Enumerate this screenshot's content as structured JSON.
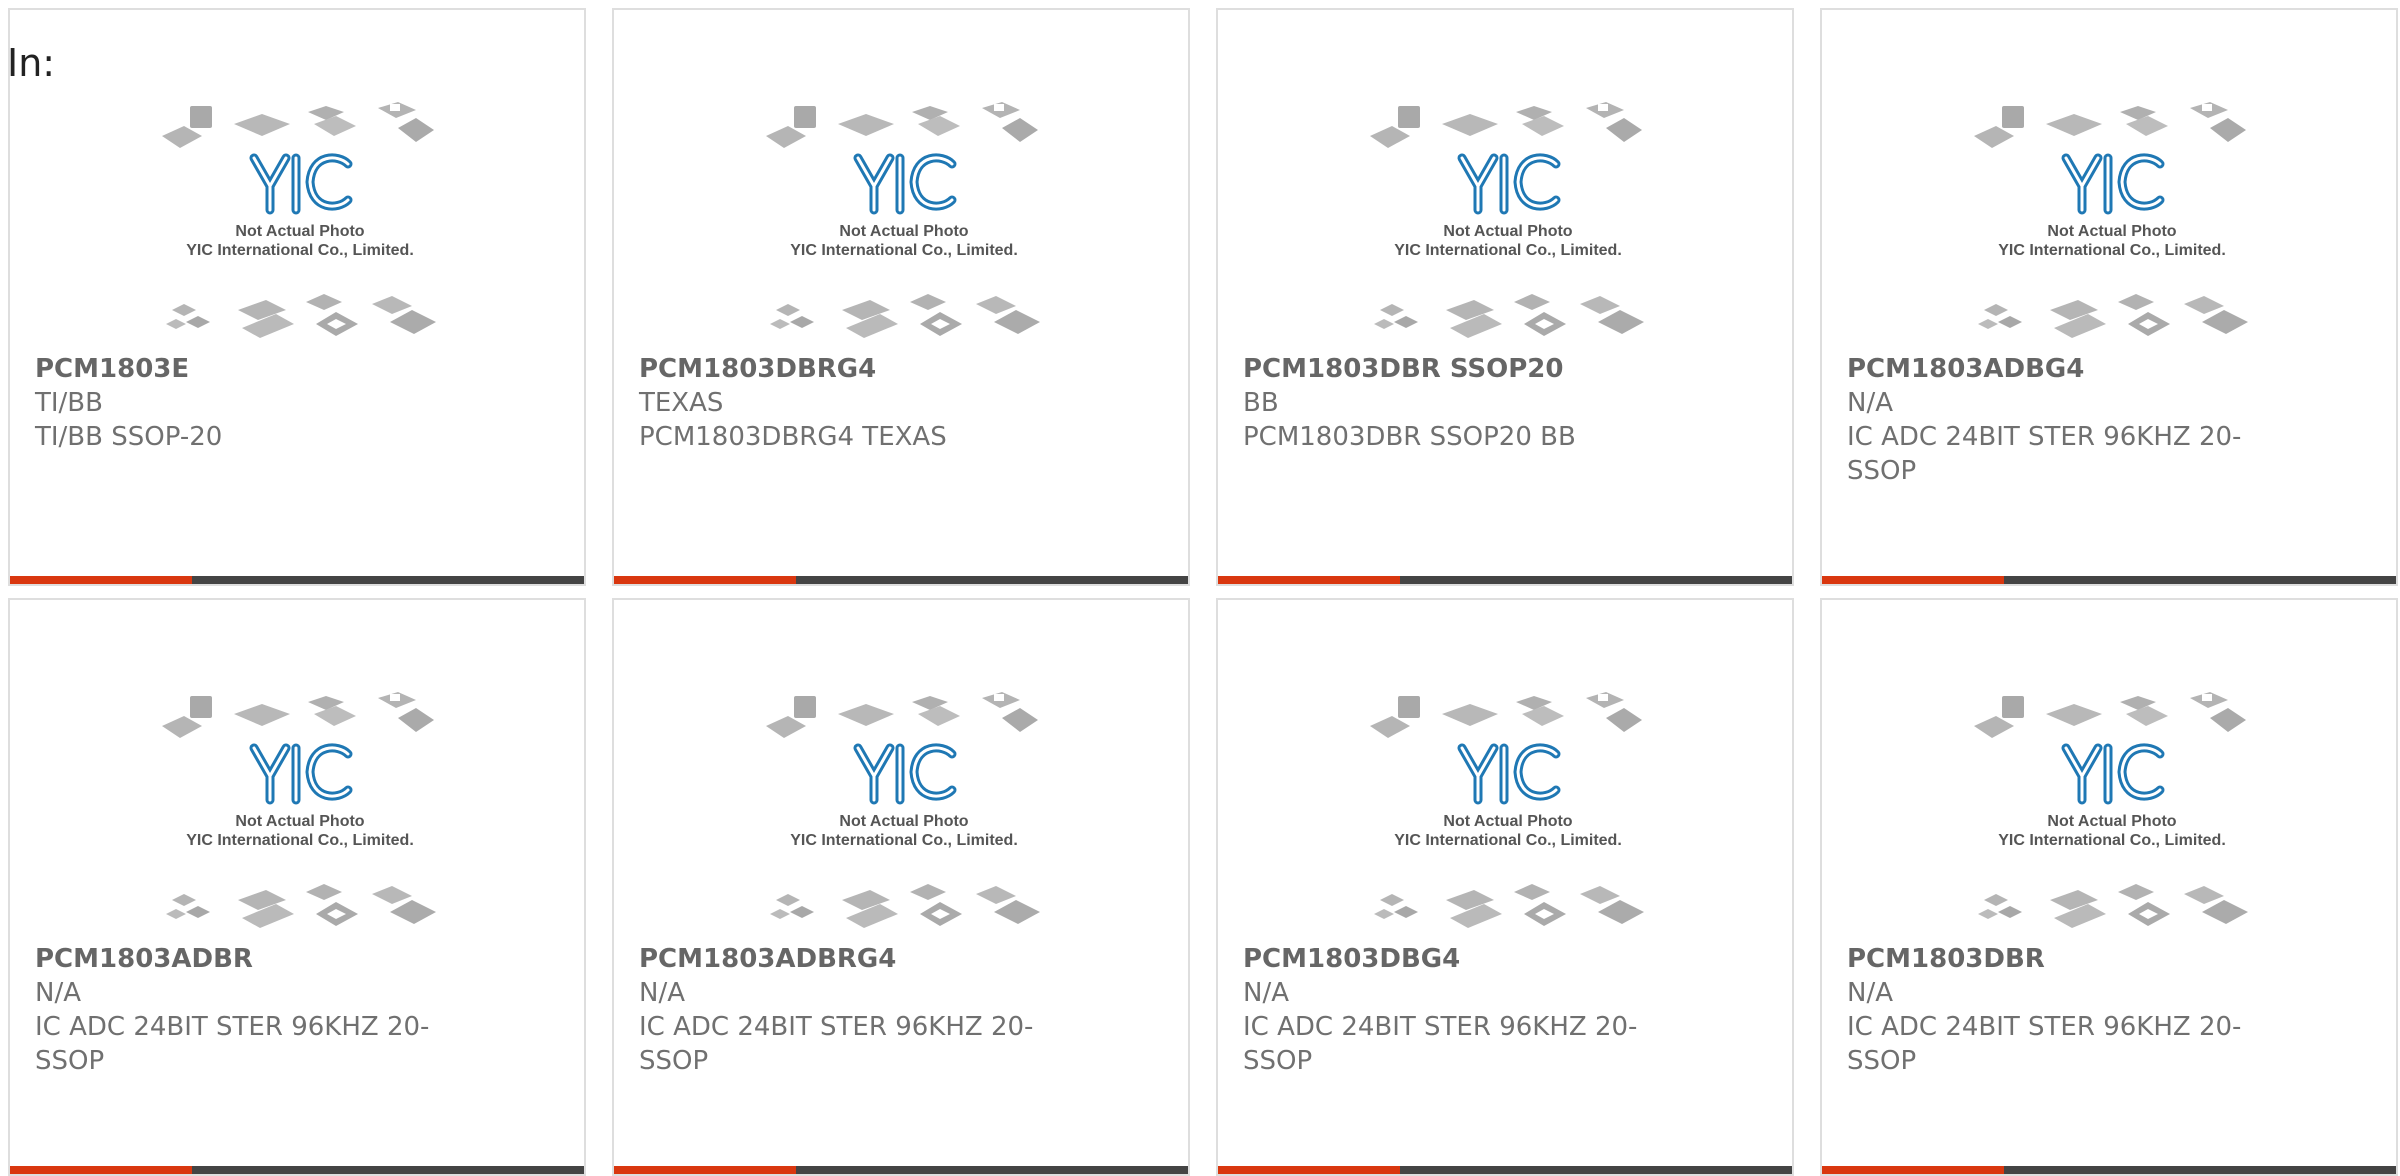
{
  "page": {
    "label": "In:"
  },
  "placeholder": {
    "line1": "Not Actual Photo",
    "line2": "YIC International Co., Limited."
  },
  "colors": {
    "accent": "#d9370f",
    "bar": "#444444",
    "logo": "#1f78b4"
  },
  "products": [
    {
      "part": "PCM1803E",
      "maker": "TI/BB",
      "desc": "TI/BB SSOP-20"
    },
    {
      "part": "PCM1803DBRG4",
      "maker": "TEXAS",
      "desc": "PCM1803DBRG4 TEXAS"
    },
    {
      "part": "PCM1803DBR SSOP20",
      "maker": "BB",
      "desc": "PCM1803DBR SSOP20 BB"
    },
    {
      "part": "PCM1803ADBG4",
      "maker": "N/A",
      "desc": "IC ADC 24BIT STER 96KHZ 20-SSOP"
    },
    {
      "part": "PCM1803ADBR",
      "maker": "N/A",
      "desc": "IC ADC 24BIT STER 96KHZ 20-SSOP"
    },
    {
      "part": "PCM1803ADBRG4",
      "maker": "N/A",
      "desc": "IC ADC 24BIT STER 96KHZ 20-SSOP"
    },
    {
      "part": "PCM1803DBG4",
      "maker": "N/A",
      "desc": "IC ADC 24BIT STER 96KHZ 20-SSOP"
    },
    {
      "part": "PCM1803DBR",
      "maker": "N/A",
      "desc": "IC ADC 24BIT STER 96KHZ 20-SSOP"
    }
  ]
}
